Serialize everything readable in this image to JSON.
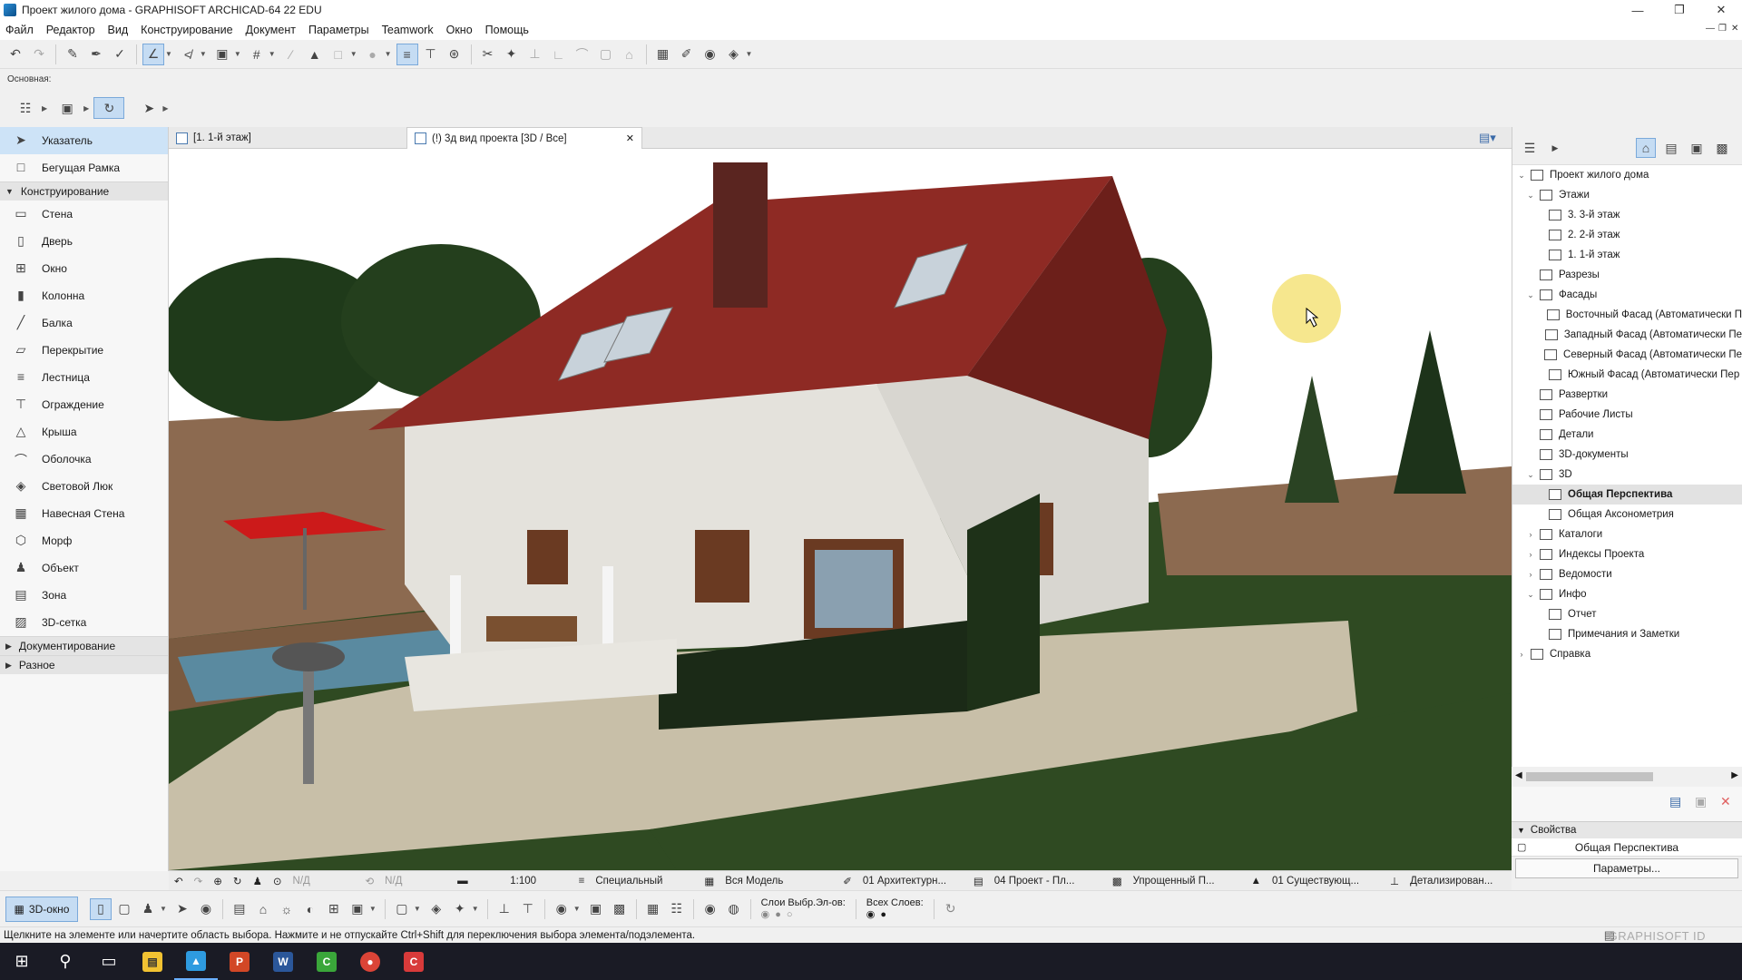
{
  "window": {
    "title": "Проект жилого дома - GRAPHISOFT ARCHICAD-64 22 EDU"
  },
  "menu": [
    "Файл",
    "Редактор",
    "Вид",
    "Конструирование",
    "Документ",
    "Параметры",
    "Teamwork",
    "Окно",
    "Помощь"
  ],
  "toolbar": {
    "label": "Основная:"
  },
  "toolbox": {
    "top": [
      {
        "label": "Указатель",
        "icon": "arrow-pointer-icon",
        "selected": true
      },
      {
        "label": "Бегущая Рамка",
        "icon": "marquee-icon",
        "selected": false
      }
    ],
    "group_design": "Конструирование",
    "design_tools": [
      {
        "label": "Стена",
        "icon": "wall-icon"
      },
      {
        "label": "Дверь",
        "icon": "door-icon"
      },
      {
        "label": "Окно",
        "icon": "window-icon"
      },
      {
        "label": "Колонна",
        "icon": "column-icon"
      },
      {
        "label": "Балка",
        "icon": "beam-icon"
      },
      {
        "label": "Перекрытие",
        "icon": "slab-icon"
      },
      {
        "label": "Лестница",
        "icon": "stair-icon"
      },
      {
        "label": "Ограждение",
        "icon": "railing-icon"
      },
      {
        "label": "Крыша",
        "icon": "roof-icon"
      },
      {
        "label": "Оболочка",
        "icon": "shell-icon"
      },
      {
        "label": "Световой Люк",
        "icon": "skylight-icon"
      },
      {
        "label": "Навесная Стена",
        "icon": "curtain-wall-icon"
      },
      {
        "label": "Морф",
        "icon": "morph-icon"
      },
      {
        "label": "Объект",
        "icon": "object-icon"
      },
      {
        "label": "Зона",
        "icon": "zone-icon"
      },
      {
        "label": "3D-сетка",
        "icon": "mesh-icon"
      }
    ],
    "group_docs": "Документирование",
    "group_misc": "Разное"
  },
  "tabs": [
    {
      "label": "[1. 1-й этаж]"
    },
    {
      "label": "(!) 3д вид проекта [3D / Все]"
    }
  ],
  "viewcontrols": [
    "N/Д",
    "N/Д",
    "1:100",
    "Специальный",
    "Вся Модель",
    "01 Архитектурн...",
    "04 Проект - Пл...",
    "Упрощенный П...",
    "01 Существующ...",
    "Детализирован..."
  ],
  "bottom": {
    "btn3d": "3D-окно",
    "layers_sel": "Слои Выбр.Эл-ов:",
    "layers_all": "Всех Слоев:"
  },
  "status": {
    "text": "Щелкните на элементе или начертите область выбора. Нажмите и не отпускайте Ctrl+Shift для переключения выбора элемента/подэлемента.",
    "brand": "GRAPHISOFT ID"
  },
  "navigator": [
    {
      "label": "Проект жилого дома",
      "level": 0,
      "tg": "v"
    },
    {
      "label": "Этажи",
      "level": 1,
      "tg": "v"
    },
    {
      "label": "3. 3-й этаж",
      "level": 2,
      "tg": ""
    },
    {
      "label": "2. 2-й этаж",
      "level": 2,
      "tg": ""
    },
    {
      "label": "1. 1-й этаж",
      "level": 2,
      "tg": ""
    },
    {
      "label": "Разрезы",
      "level": 1,
      "tg": ""
    },
    {
      "label": "Фасады",
      "level": 1,
      "tg": "v"
    },
    {
      "label": "Восточный Фасад (Автоматически П",
      "level": 2,
      "tg": ""
    },
    {
      "label": "Западный Фасад (Автоматически Пе",
      "level": 2,
      "tg": ""
    },
    {
      "label": "Северный Фасад (Автоматически Пе",
      "level": 2,
      "tg": ""
    },
    {
      "label": "Южный Фасад (Автоматически Пер",
      "level": 2,
      "tg": ""
    },
    {
      "label": "Развертки",
      "level": 1,
      "tg": ""
    },
    {
      "label": "Рабочие Листы",
      "level": 1,
      "tg": ""
    },
    {
      "label": "Детали",
      "level": 1,
      "tg": ""
    },
    {
      "label": "3D-документы",
      "level": 1,
      "tg": ""
    },
    {
      "label": "3D",
      "level": 1,
      "tg": "v"
    },
    {
      "label": "Общая Перспектива",
      "level": 2,
      "tg": "",
      "selected": true
    },
    {
      "label": "Общая Аксонометрия",
      "level": 2,
      "tg": ""
    },
    {
      "label": "Каталоги",
      "level": 1,
      "tg": ">"
    },
    {
      "label": "Индексы Проекта",
      "level": 1,
      "tg": ">"
    },
    {
      "label": "Ведомости",
      "level": 1,
      "tg": ">"
    },
    {
      "label": "Инфо",
      "level": 1,
      "tg": "v"
    },
    {
      "label": "Отчет",
      "level": 2,
      "tg": ""
    },
    {
      "label": "Примечания и Заметки",
      "level": 2,
      "tg": ""
    },
    {
      "label": "Справка",
      "level": 0,
      "tg": ">"
    }
  ],
  "properties": {
    "header": "Свойства",
    "value": "Общая Перспектива",
    "button": "Параметры..."
  }
}
